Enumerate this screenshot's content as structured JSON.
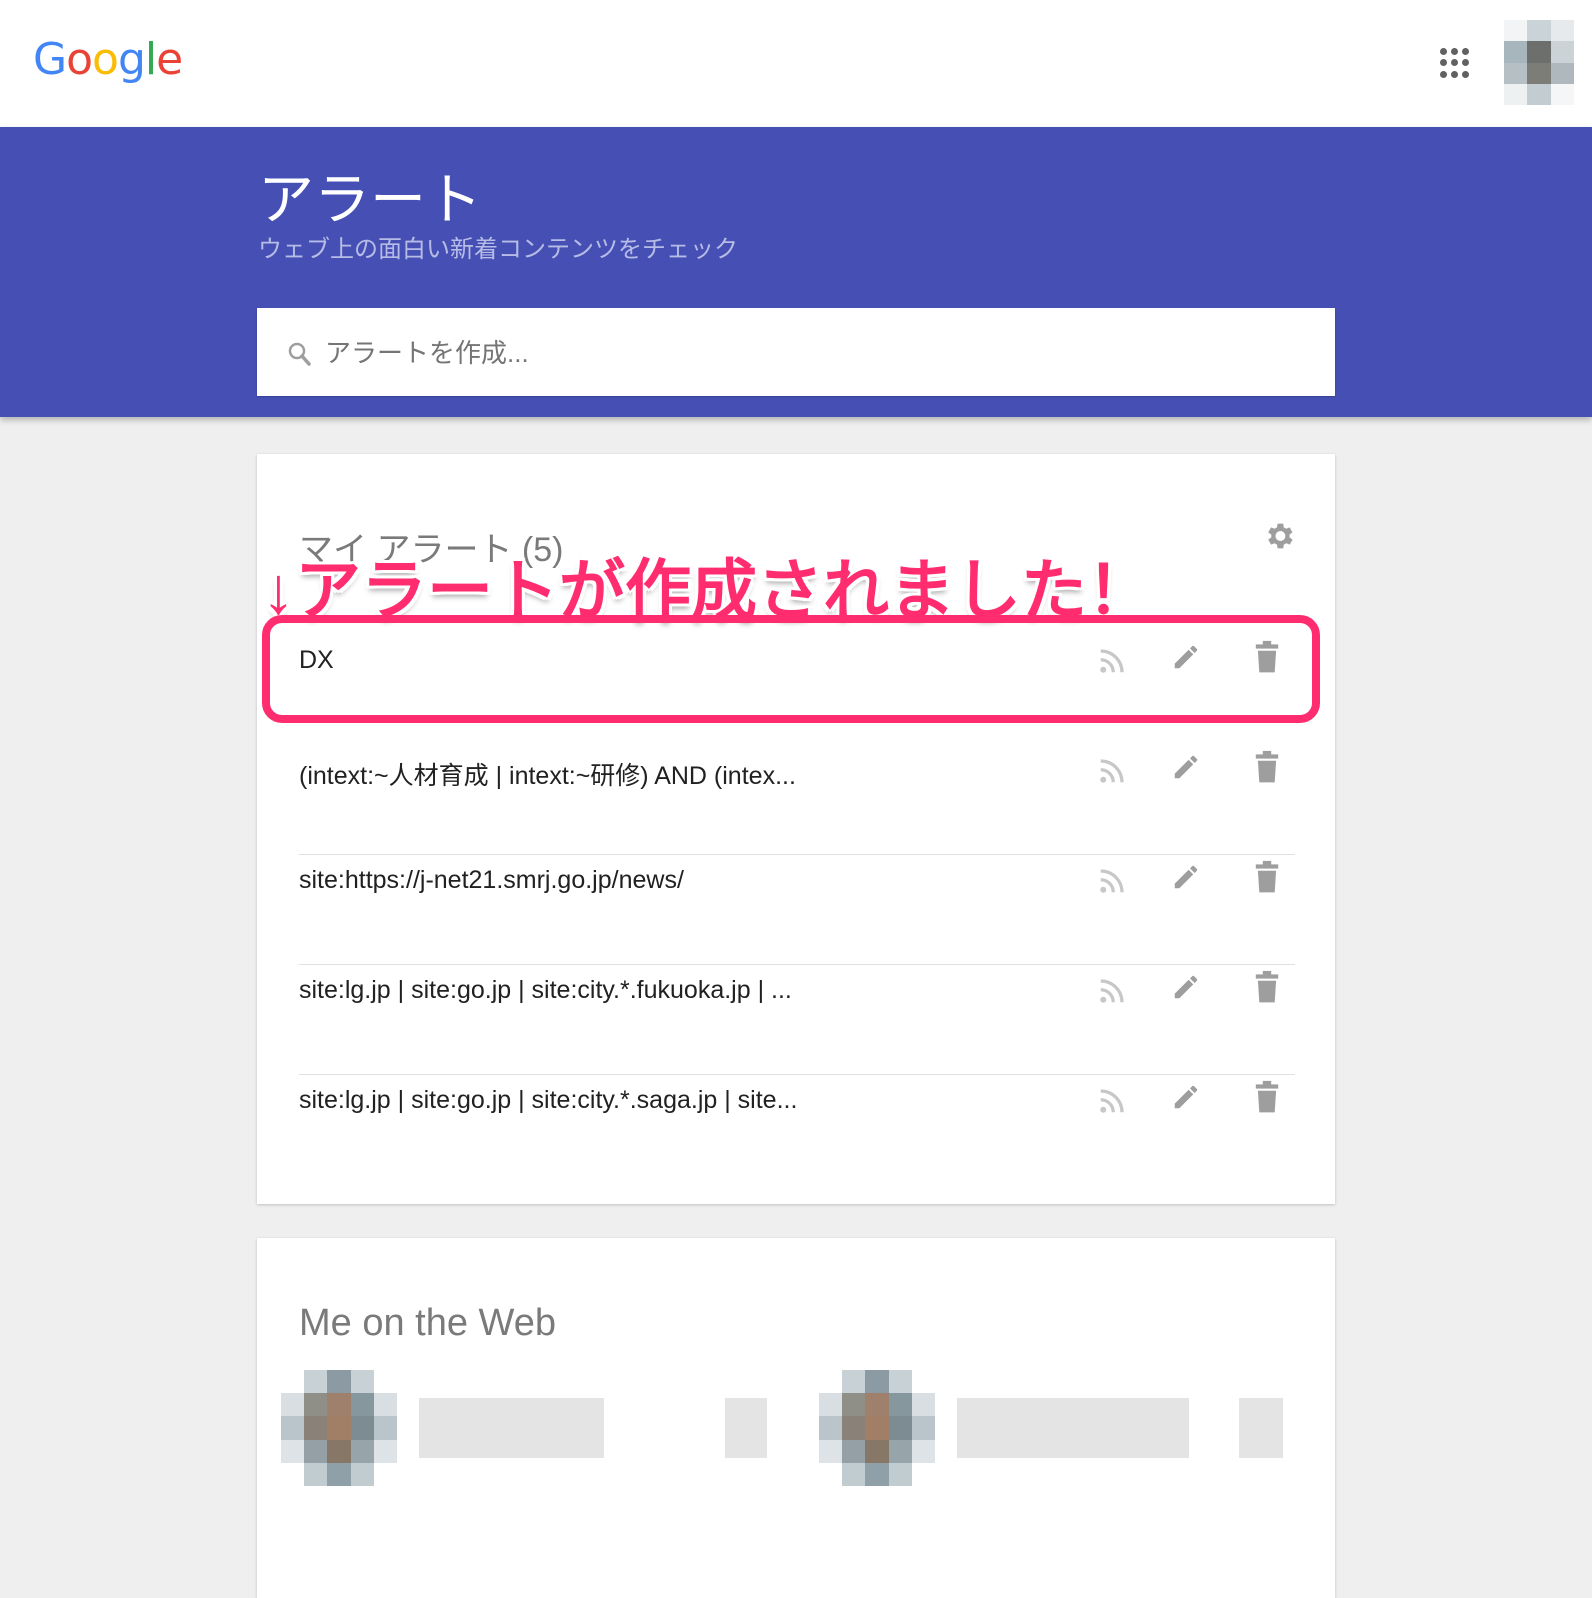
{
  "header": {
    "logo_letters": [
      {
        "ch": "G",
        "color": "#4285F4"
      },
      {
        "ch": "o",
        "color": "#EA4335"
      },
      {
        "ch": "o",
        "color": "#FBBC05"
      },
      {
        "ch": "g",
        "color": "#4285F4"
      },
      {
        "ch": "l",
        "color": "#34A853"
      },
      {
        "ch": "e",
        "color": "#EA4335"
      }
    ],
    "apps_icon": "apps-grid-icon",
    "avatar_icon": "account-avatar"
  },
  "hero": {
    "title": "アラート",
    "subtitle": "ウェブ上の面白い新着コンテンツをチェック",
    "background": "#4650b4"
  },
  "search": {
    "placeholder": "アラートを作成...",
    "value": ""
  },
  "alerts": {
    "title": "マイ アラート (5)",
    "items": [
      {
        "query": "DX"
      },
      {
        "query": "(intext:~人材育成 | intext:~研修) AND (intex..."
      },
      {
        "query": "site:https://j-net21.smrj.go.jp/news/"
      },
      {
        "query": "site:lg.jp | site:go.jp | site:city.*.fukuoka.jp | ..."
      },
      {
        "query": "site:lg.jp | site:go.jp | site:city.*.saga.jp | site..."
      }
    ],
    "row_icons": [
      "rss-icon",
      "edit-pencil-icon",
      "delete-trash-icon"
    ]
  },
  "annotation": {
    "text": "↓アラートが作成されました！",
    "color": "#ff2d6f"
  },
  "me_on_web": {
    "title": "Me on the Web"
  }
}
